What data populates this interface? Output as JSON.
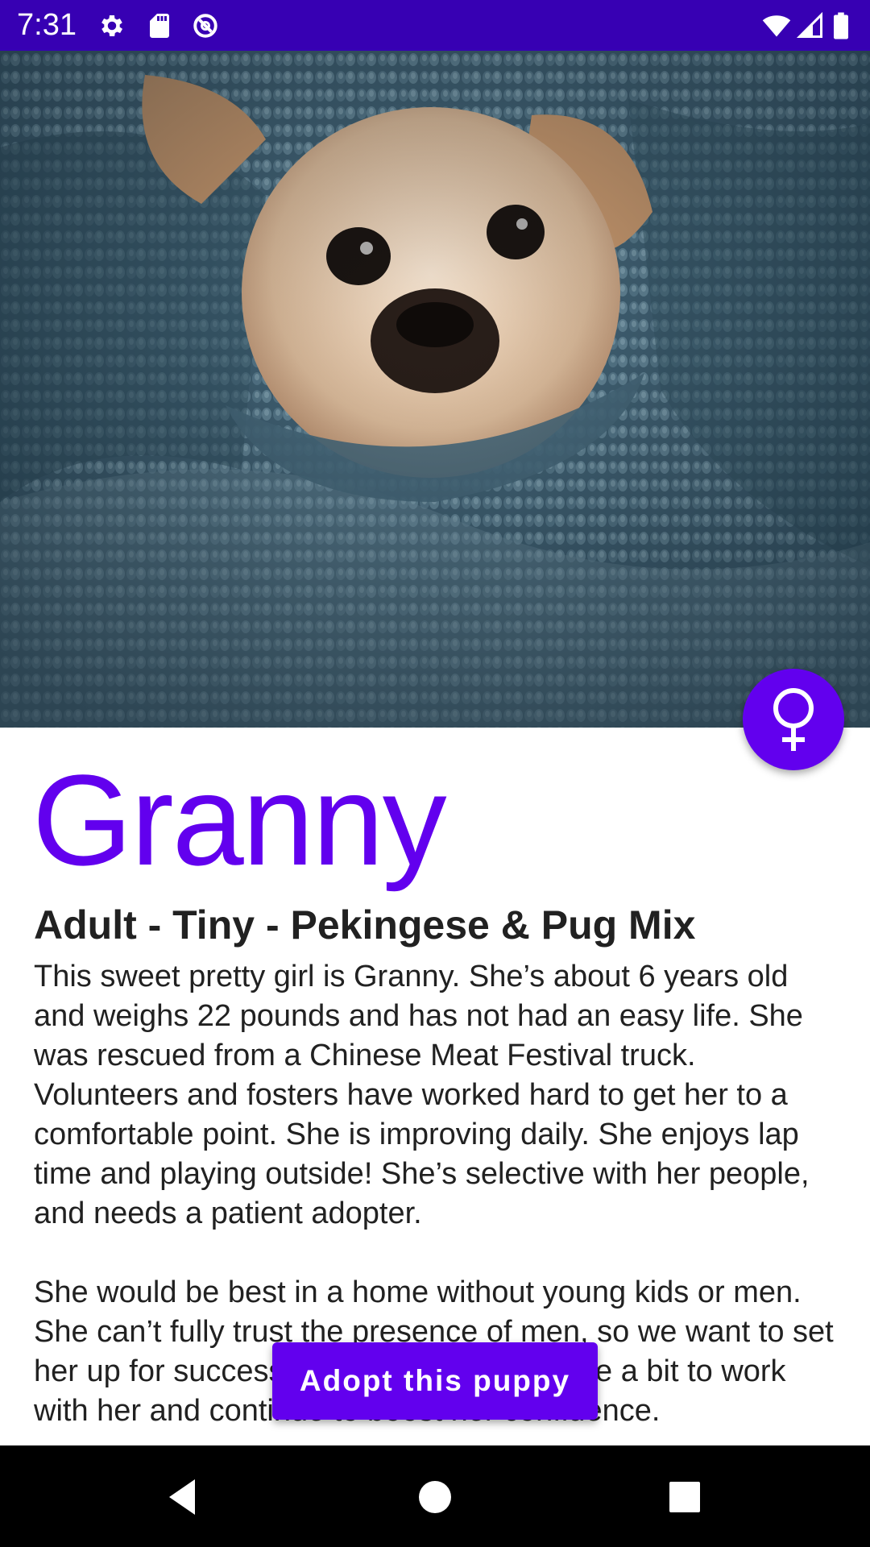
{
  "status_bar": {
    "time": "7:31",
    "icons_left": [
      "settings-icon",
      "sd-card-icon",
      "data-saver-icon"
    ],
    "icons_right": [
      "wifi-icon",
      "cell-signal-icon",
      "battery-icon"
    ]
  },
  "hero": {
    "image": "dog-wrapped-in-blue-knit-blanket"
  },
  "fab": {
    "icon": "female-symbol-icon"
  },
  "pet": {
    "name": "Granny",
    "subtitle": "Adult - Tiny - Pekingese & Pug Mix",
    "description": [
      "This sweet pretty girl is Granny. She’s about 6 years old and weighs 22 pounds and has not had an easy life. She was rescued from a Chinese Meat Festival truck. Volunteers and fosters have worked hard to get her to a comfortable point. She is improving daily. She enjoys lap time and playing outside! She’s selective with her people, and needs a patient adopter.",
      "She would be best in a home without young kids or men. She can’t fully trust the presence of men, so we want to set her up for success. Someone who is home a bit to work with her and continue to boost her confidence."
    ]
  },
  "actions": {
    "adopt_label": "Adopt this puppy"
  },
  "nav_bar": {
    "icons": [
      "back-icon",
      "home-icon",
      "recents-icon"
    ]
  },
  "colors": {
    "status_bar": "#3700B3",
    "accent": "#6200EE",
    "text": "#212121",
    "nav_bar": "#000000"
  }
}
